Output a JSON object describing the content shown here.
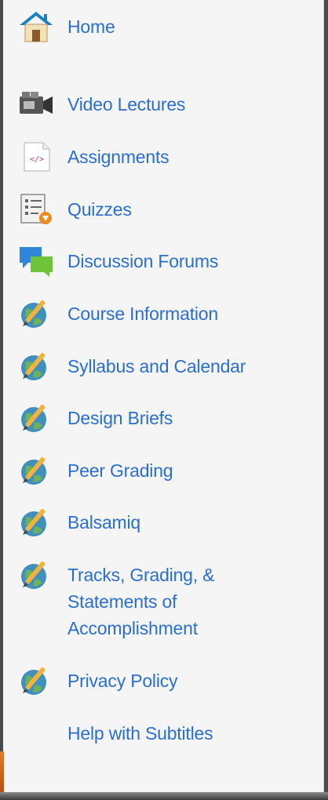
{
  "nav": {
    "items": [
      {
        "label": "Home",
        "icon": "home-icon"
      },
      {
        "label": "Video Lectures",
        "icon": "video-camera-icon"
      },
      {
        "label": "Assignments",
        "icon": "code-document-icon"
      },
      {
        "label": "Quizzes",
        "icon": "quiz-checklist-icon"
      },
      {
        "label": "Discussion Forums",
        "icon": "chat-bubbles-icon"
      },
      {
        "label": "Course Information",
        "icon": "globe-pencil-icon"
      },
      {
        "label": "Syllabus and Calendar",
        "icon": "globe-pencil-icon"
      },
      {
        "label": "Design Briefs",
        "icon": "globe-pencil-icon"
      },
      {
        "label": "Peer Grading",
        "icon": "globe-pencil-icon"
      },
      {
        "label": "Balsamiq",
        "icon": "globe-pencil-icon"
      },
      {
        "label": "Tracks, Grading, &\nStatements of\nAccomplishment",
        "icon": "globe-pencil-icon"
      },
      {
        "label": "Privacy Policy",
        "icon": "globe-pencil-icon"
      },
      {
        "label": "Help with Subtitles",
        "icon": ""
      }
    ]
  },
  "colors": {
    "link": "#2a6fd0",
    "panel_background": "#f5f5f5",
    "accent_strip": "#e07b2a"
  }
}
